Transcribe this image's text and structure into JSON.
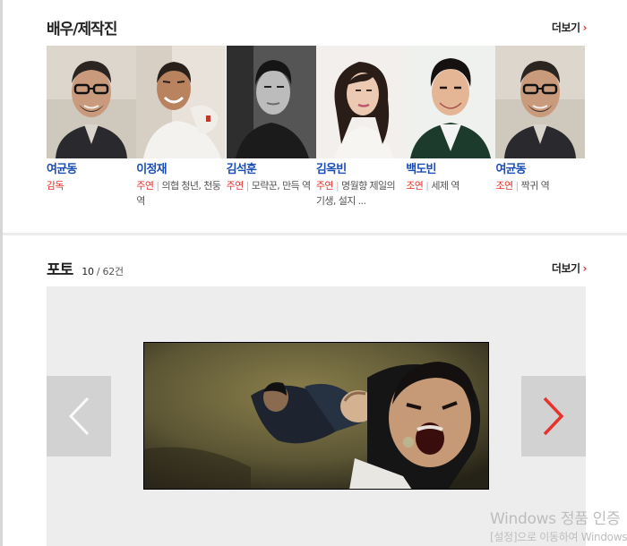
{
  "cast_section": {
    "title": "배우/제작진",
    "more_label": "더보기",
    "items": [
      {
        "name": "여균동",
        "role_type": "감독",
        "role_desc": ""
      },
      {
        "name": "이정재",
        "role_type": "주연",
        "role_desc": "의협 청년, 천둥 역"
      },
      {
        "name": "김석훈",
        "role_type": "주연",
        "role_desc": "모략꾼, 만득 역"
      },
      {
        "name": "김옥빈",
        "role_type": "주연",
        "role_desc": "명월향 제일의 기생, 설지 ..."
      },
      {
        "name": "백도빈",
        "role_type": "조연",
        "role_desc": "세제 역"
      },
      {
        "name": "여균동",
        "role_type": "조연",
        "role_desc": "짝귀 역"
      }
    ]
  },
  "photo_section": {
    "title": "포토",
    "count_current": "10",
    "count_separator": " / ",
    "count_total": "62건",
    "more_label": "더보기",
    "prev_icon": "chevron-left-icon",
    "next_icon": "chevron-right-icon"
  },
  "watermark": {
    "line1": "Windows 정품 인증",
    "line2": "[설정]으로 이동하여 Windows"
  },
  "colors": {
    "link_blue": "#1a4db4",
    "accent_red": "#e8332c",
    "photo_bg": "#ededed",
    "nav_btn": "#d2d2d2"
  }
}
